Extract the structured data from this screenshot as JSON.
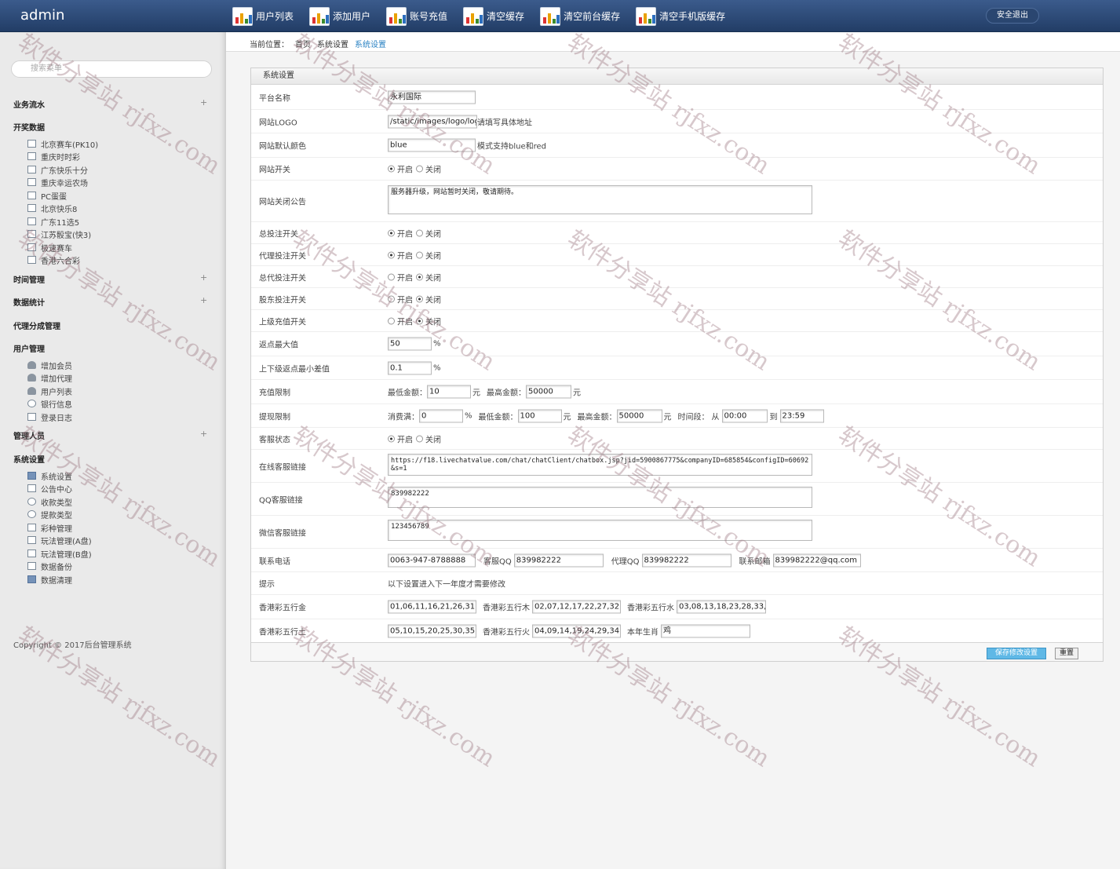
{
  "app": {
    "brand": "admin",
    "logout": "安全退出"
  },
  "topnav": [
    "用户列表",
    "添加用户",
    "账号充值",
    "清空缓存",
    "清空前台缓存",
    "清空手机版缓存"
  ],
  "breadcrumb": {
    "prefix": "当前位置：",
    "items": [
      "首页",
      "系统设置",
      "系统设置"
    ]
  },
  "sidebar": {
    "search_placeholder": "搜索菜单",
    "sections": [
      {
        "title": "业务流水",
        "plus": "+"
      },
      {
        "title": "开奖数据",
        "items": [
          "北京赛车(PK10)",
          "重庆时时彩",
          "广东快乐十分",
          "重庆幸运农场",
          "PC蛋蛋",
          "北京快乐8",
          "广东11选5",
          "江苏骰宝(快3)",
          "极速赛车",
          "香港六合彩"
        ]
      },
      {
        "title": "时间管理",
        "plus": "+"
      },
      {
        "title": "数据统计",
        "plus": "+"
      },
      {
        "title": "代理分成管理"
      },
      {
        "title": "用户管理",
        "items": [
          "增加会员",
          "增加代理",
          "用户列表",
          "银行信息",
          "登录日志"
        ]
      },
      {
        "title": "管理人员",
        "plus": "+"
      },
      {
        "title": "系统设置",
        "items": [
          "系统设置",
          "公告中心",
          "收款类型",
          "提款类型",
          "彩种管理",
          "玩法管理(A盘)",
          "玩法管理(B盘)",
          "数据备份",
          "数据清理"
        ]
      }
    ],
    "copyright": "Copyright © 2017后台管理系统"
  },
  "panel": {
    "title": "系统设置",
    "platform_name": {
      "label": "平台名称",
      "value": "永利国际"
    },
    "logo": {
      "label": "网站LOGO",
      "value": "/static/images/logo/logo_s",
      "hint": "请填写具体地址"
    },
    "default_color": {
      "label": "网站默认颜色",
      "value": "blue",
      "hint": "模式支持blue和red"
    },
    "site_switch": {
      "label": "网站开关",
      "on": "开启",
      "off": "关闭",
      "selected": "on"
    },
    "close_notice": {
      "label": "网站关闭公告",
      "value": "服务器升级，网站暂时关闭，敬请期待。"
    },
    "total_bet": {
      "label": "总投注开关",
      "on": "开启",
      "off": "关闭",
      "selected": "on"
    },
    "agent_bet": {
      "label": "代理投注开关",
      "on": "开启",
      "off": "关闭",
      "selected": "on"
    },
    "general_agent_bet": {
      "label": "总代投注开关",
      "on": "开启",
      "off": "关闭",
      "selected": "off"
    },
    "shareholder_bet": {
      "label": "股东投注开关",
      "on": "开启",
      "off": "关闭",
      "selected": "off"
    },
    "upper_recharge": {
      "label": "上级充值开关",
      "on": "开启",
      "off": "关闭",
      "selected": "off"
    },
    "rebate_max": {
      "label": "返点最大值",
      "value": "50",
      "unit": "%"
    },
    "rebate_diff": {
      "label": "上下级返点最小差值",
      "value": "0.1",
      "unit": "%"
    },
    "recharge_limit": {
      "label": "充值限制",
      "min_label": "最低金额：",
      "min": "10",
      "unit": "元",
      "max_label": "最高金额：",
      "max": "50000"
    },
    "withdraw_limit": {
      "label": "提现限制",
      "fee_label": "消费满：",
      "fee": "0",
      "fee_unit": "%",
      "min_label": "最低金额：",
      "min": "100",
      "unit": "元",
      "max_label": "最高金额：",
      "max": "50000",
      "time_label": "时间段：",
      "from_label": "从",
      "from": "00:00",
      "to_label": "到",
      "to": "23:59"
    },
    "service_status": {
      "label": "客服状态",
      "on": "开启",
      "off": "关闭",
      "selected": "on"
    },
    "online_service": {
      "label": "在线客服链接",
      "value": "https://f18.livechatvalue.com/chat/chatClient/chatbox.jsp?jid=5900867775&companyID=685854&configID=60692&s=1"
    },
    "qq_service": {
      "label": "QQ客服链接",
      "value": "839982222"
    },
    "wechat_service": {
      "label": "微信客服链接",
      "value": "123456789"
    },
    "contact": {
      "label": "联系电话",
      "phone": "0063-947-8788888",
      "qq_label": "客服QQ",
      "qq": "839982222",
      "agent_qq_label": "代理QQ",
      "agent_qq": "839982222",
      "email_label": "联系邮箱",
      "email": "839982222@qq.com"
    },
    "notice": {
      "label": "提示",
      "value": "以下设置进入下一年度才需要修改"
    },
    "wuxing1": {
      "label": "香港彩五行金",
      "value": "01,06,11,16,21,26,31,36,4",
      "label2": "香港彩五行木",
      "value2": "02,07,12,17,22,27,32,37,4",
      "label3": "香港彩五行水",
      "value3": "03,08,13,18,23,28,33,38,4"
    },
    "wuxing2": {
      "label": "香港彩五行土",
      "value": "05,10,15,20,25,30,35,40,4",
      "label2": "香港彩五行火",
      "value2": "04,09,14,19,24,29,34,39,4",
      "label3": "本年生肖",
      "value3": "鸡"
    },
    "save": "保存修改设置",
    "reset": "重置"
  },
  "watermark": "软件分享站 rjfxz.com"
}
